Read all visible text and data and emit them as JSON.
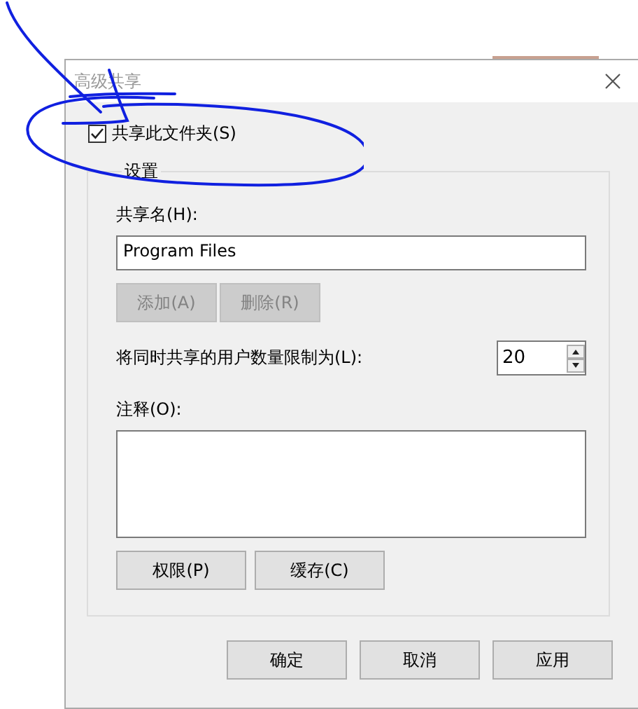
{
  "window": {
    "title": "高级共享"
  },
  "share_folder": {
    "label": "共享此文件夹(S)",
    "checked": true
  },
  "settings": {
    "legend": "设置",
    "share_name_label": "共享名(H):",
    "share_name": "Program Files",
    "share_name_buttons": [
      {
        "label": "添加(A)",
        "disabled": true
      },
      {
        "label": "删除(R)",
        "disabled": true
      }
    ],
    "user_limit_label": "将同时共享的用户数量限制为(L):",
    "user_limit": "20",
    "comment_label": "注释(O):",
    "buttons": [
      "权限(P)",
      "缓存(C)"
    ]
  },
  "buttons": [
    "确定",
    "取消",
    "应用"
  ]
}
